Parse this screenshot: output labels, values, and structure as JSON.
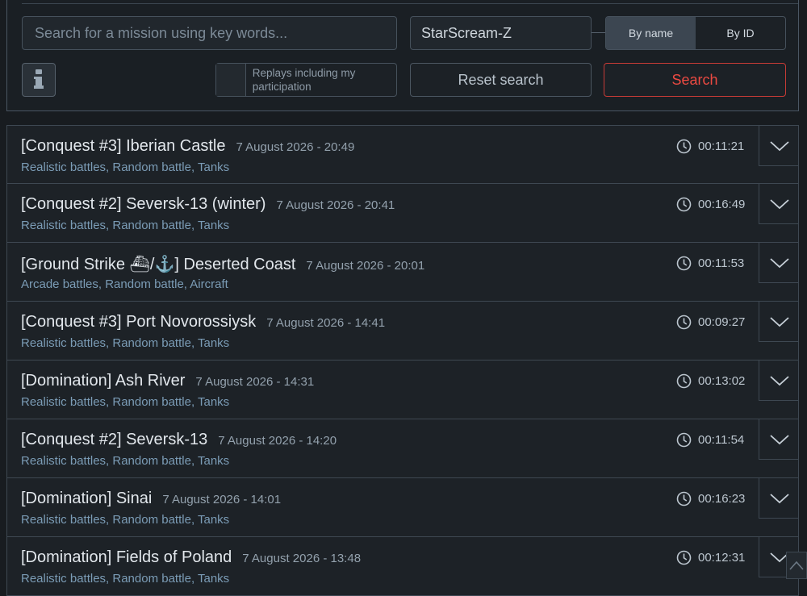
{
  "search": {
    "placeholder": "Search for a mission using key words...",
    "player_value": "StarScream-Z",
    "mode_options": [
      "By name",
      "By ID"
    ],
    "active_mode": "By name",
    "checkbox_label": "Replays including my participation",
    "reset_label": "Reset search",
    "search_label": "Search"
  },
  "icons": {
    "info": "info-icon",
    "clock": "clock-icon",
    "expand": "chevron-down-icon",
    "scroll_top": "chevron-up-icon"
  },
  "colors": {
    "accent_red": "#ec4a42",
    "tag_blue": "#7b9cb6",
    "active_toggle": "#3c4651"
  },
  "replays": [
    {
      "title": "[Conquest #3] Iberian Castle",
      "date": "7 August 2026 - 20:49",
      "tags": "Realistic battles, Random battle, Tanks",
      "duration": "00:11:21"
    },
    {
      "title": "[Conquest #2] Seversk-13 (winter)",
      "date": "7 August 2026 - 20:41",
      "tags": "Realistic battles, Random battle, Tanks",
      "duration": "00:16:49"
    },
    {
      "title": "[Ground Strike ⛴/⚓] Deserted Coast",
      "date": "7 August 2026 - 20:01",
      "tags": "Arcade battles, Random battle, Aircraft",
      "duration": "00:11:53"
    },
    {
      "title": "[Conquest #3] Port Novorossiysk",
      "date": "7 August 2026 - 14:41",
      "tags": "Realistic battles, Random battle, Tanks",
      "duration": "00:09:27"
    },
    {
      "title": "[Domination] Ash River",
      "date": "7 August 2026 - 14:31",
      "tags": "Realistic battles, Random battle, Tanks",
      "duration": "00:13:02"
    },
    {
      "title": "[Conquest #2] Seversk-13",
      "date": "7 August 2026 - 14:20",
      "tags": "Realistic battles, Random battle, Tanks",
      "duration": "00:11:54"
    },
    {
      "title": "[Domination] Sinai",
      "date": "7 August 2026 - 14:01",
      "tags": "Realistic battles, Random battle, Tanks",
      "duration": "00:16:23"
    },
    {
      "title": "[Domination] Fields of Poland",
      "date": "7 August 2026 - 13:48",
      "tags": "Realistic battles, Random battle, Tanks",
      "duration": "00:12:31"
    }
  ]
}
